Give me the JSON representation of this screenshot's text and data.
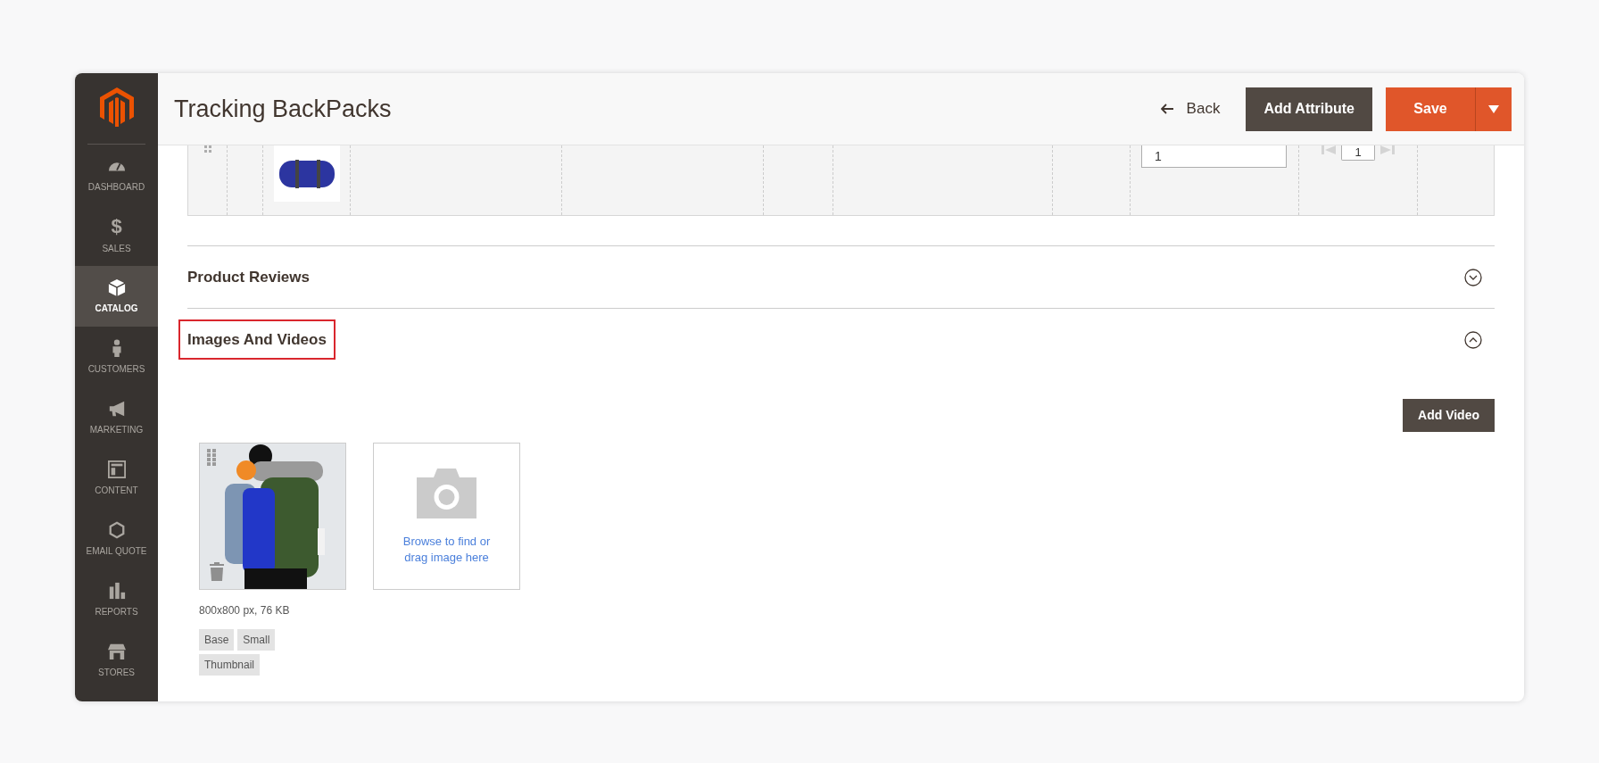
{
  "sidebar": {
    "items": [
      {
        "kind": "dashboard",
        "label": "DASHBOARD",
        "selected": false
      },
      {
        "kind": "sales",
        "glyph": "$",
        "label": "SALES",
        "selected": false
      },
      {
        "kind": "catalog",
        "label": "CATALOG",
        "selected": true
      },
      {
        "kind": "customers",
        "label": "CUSTOMERS",
        "selected": false
      },
      {
        "kind": "marketing",
        "label": "MARKETING",
        "selected": false
      },
      {
        "kind": "content",
        "label": "CONTENT",
        "selected": false
      },
      {
        "kind": "quote",
        "label": "EMAIL QUOTE",
        "selected": false
      },
      {
        "kind": "reports",
        "label": "REPORTS",
        "selected": false
      },
      {
        "kind": "stores",
        "label": "STORES",
        "selected": false
      }
    ]
  },
  "header": {
    "title": "Tracking BackPacks",
    "back": "Back",
    "add_attribute": "Add Attribute",
    "save": "Save"
  },
  "related_row": {
    "quantity": "1",
    "page": "1"
  },
  "sections": [
    {
      "title": "Product Reviews",
      "expanded": false,
      "highlighted": false
    },
    {
      "title": "Images And Videos",
      "expanded": true,
      "highlighted": true
    }
  ],
  "images": {
    "add_video": "Add Video",
    "image": {
      "info": "800x800 px, 76 KB",
      "roles": [
        "Base",
        "Small",
        "Thumbnail"
      ]
    },
    "upload": {
      "text": "Browse to find or drag image here"
    }
  }
}
